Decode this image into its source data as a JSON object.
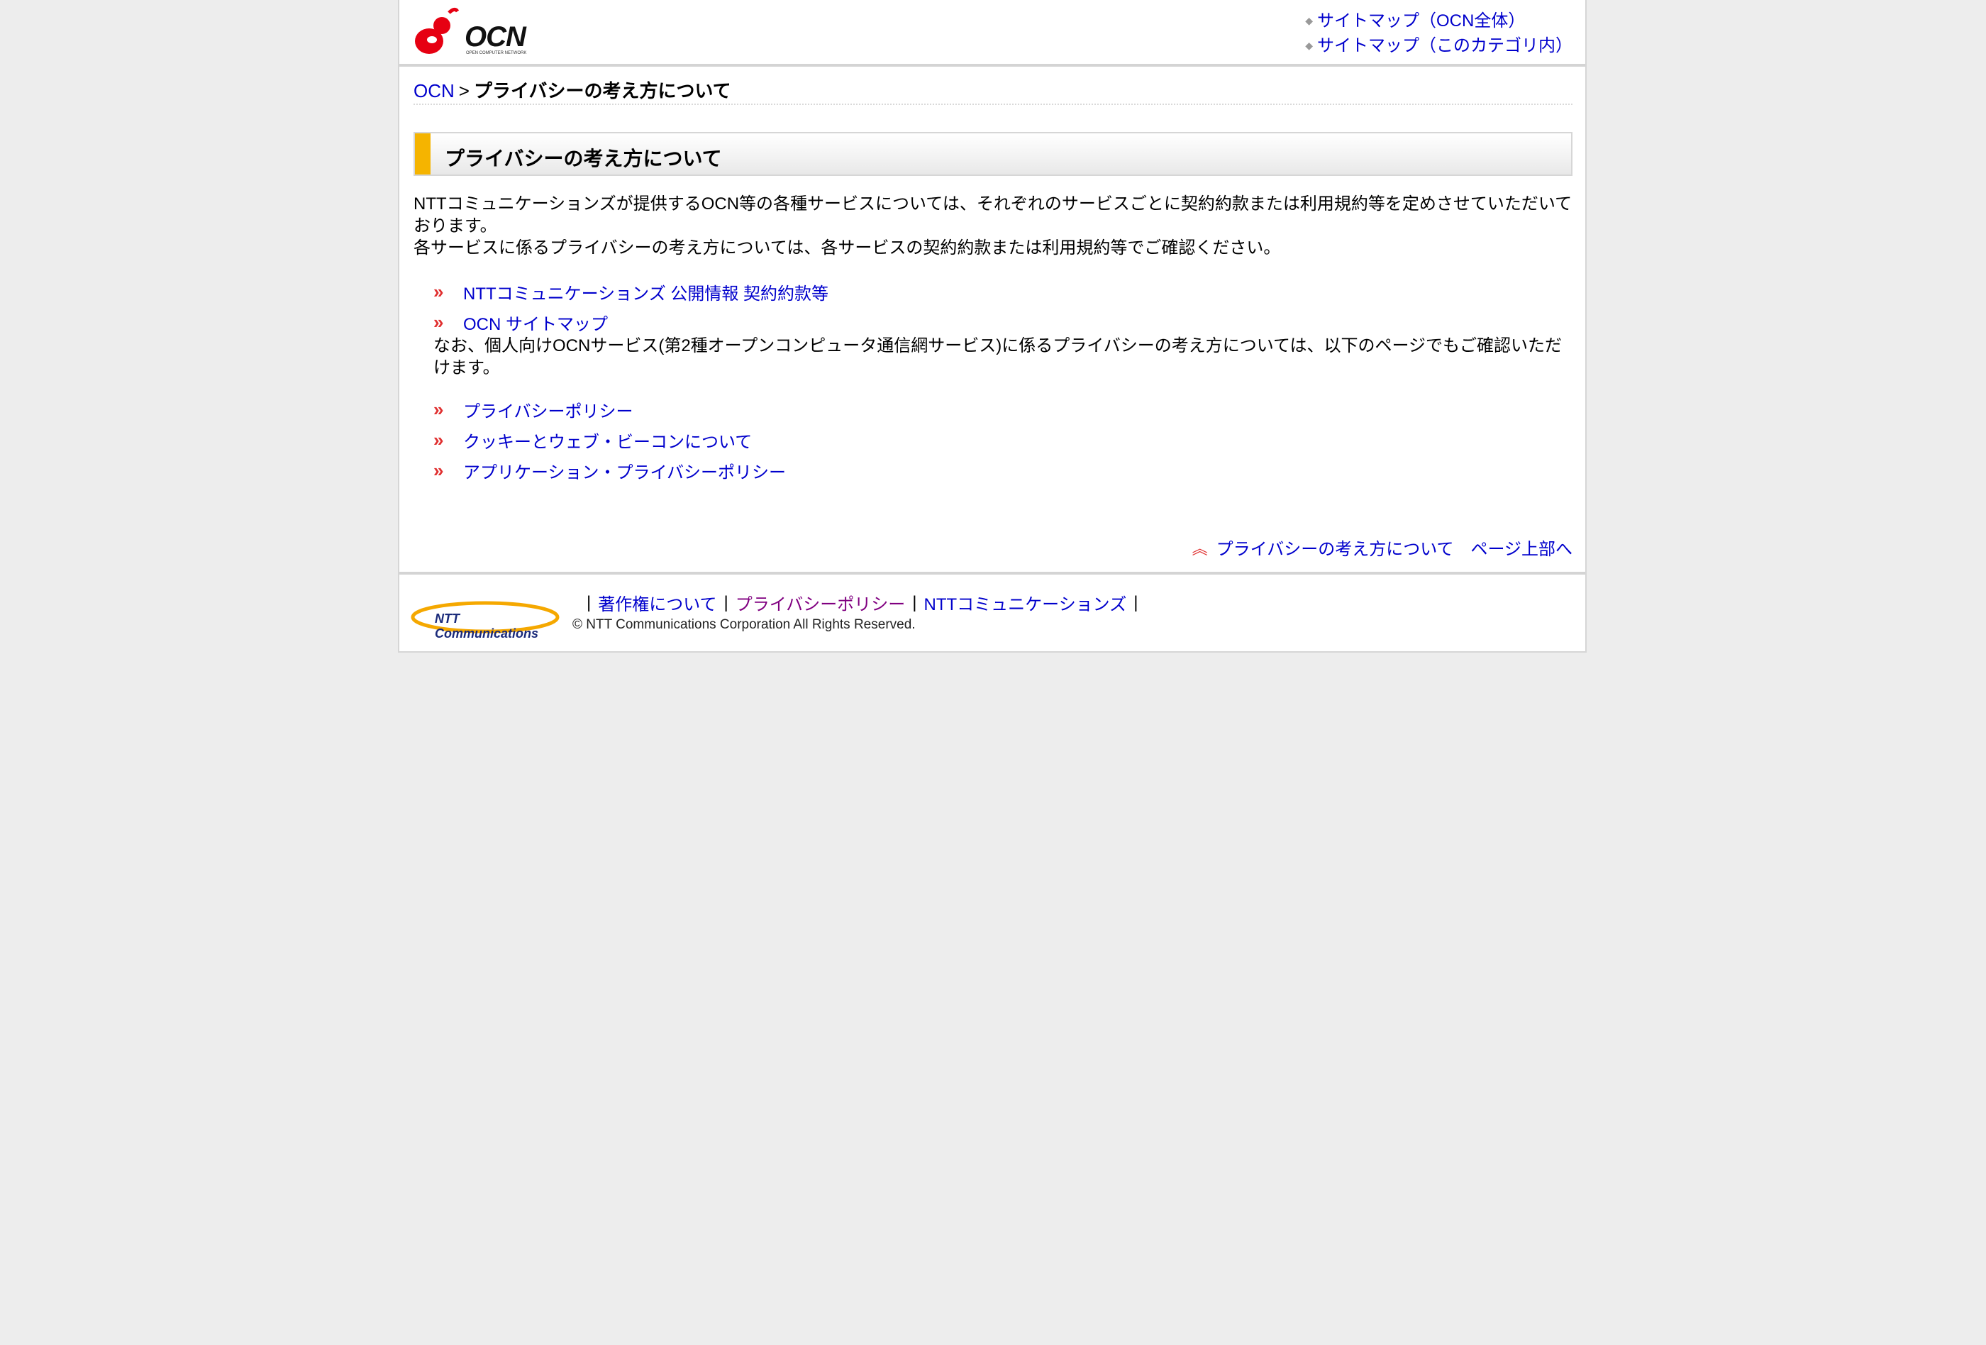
{
  "header": {
    "logo_text": "OCN",
    "logo_subtext": "OPEN COMPUTER NETWORK",
    "sitemap_links": [
      "サイトマップ（OCN全体）",
      "サイトマップ（このカテゴリ内）"
    ]
  },
  "breadcrumb": {
    "home": "OCN",
    "separator": ">",
    "current": "プライバシーの考え方について"
  },
  "page_title": "プライバシーの考え方について",
  "intro": {
    "line1": "NTTコミュニケーションズが提供するOCN等の各種サービスについては、それぞれのサービスごとに契約約款または利用規約等を定めさせていただいております。",
    "line2": "各サービスに係るプライバシーの考え方については、各サービスの契約約款または利用規約等でご確認ください。"
  },
  "links_group1": [
    "NTTコミュニケーションズ 公開情報 契約約款等",
    "OCN サイトマップ"
  ],
  "note": "なお、個人向けOCNサービス(第2種オープンコンピュータ通信網サービス)に係るプライバシーの考え方については、以下のページでもご確認いただけます。",
  "links_group2": [
    "プライバシーポリシー",
    "クッキーとウェブ・ビーコンについて",
    "アプリケーション・プライバシーポリシー"
  ],
  "to_top": "プライバシーの考え方について　ページ上部へ",
  "footer": {
    "logo_text": "NTT Communications",
    "links": [
      "著作権について",
      "プライバシーポリシー",
      "NTTコミュニケーションズ"
    ],
    "separator": "|",
    "copyright": "© NTT Communications Corporation All Rights Reserved."
  },
  "colors": {
    "link": "#0000cc",
    "visited": "#800080",
    "accent": "#f5b400",
    "background": "#ededed"
  }
}
